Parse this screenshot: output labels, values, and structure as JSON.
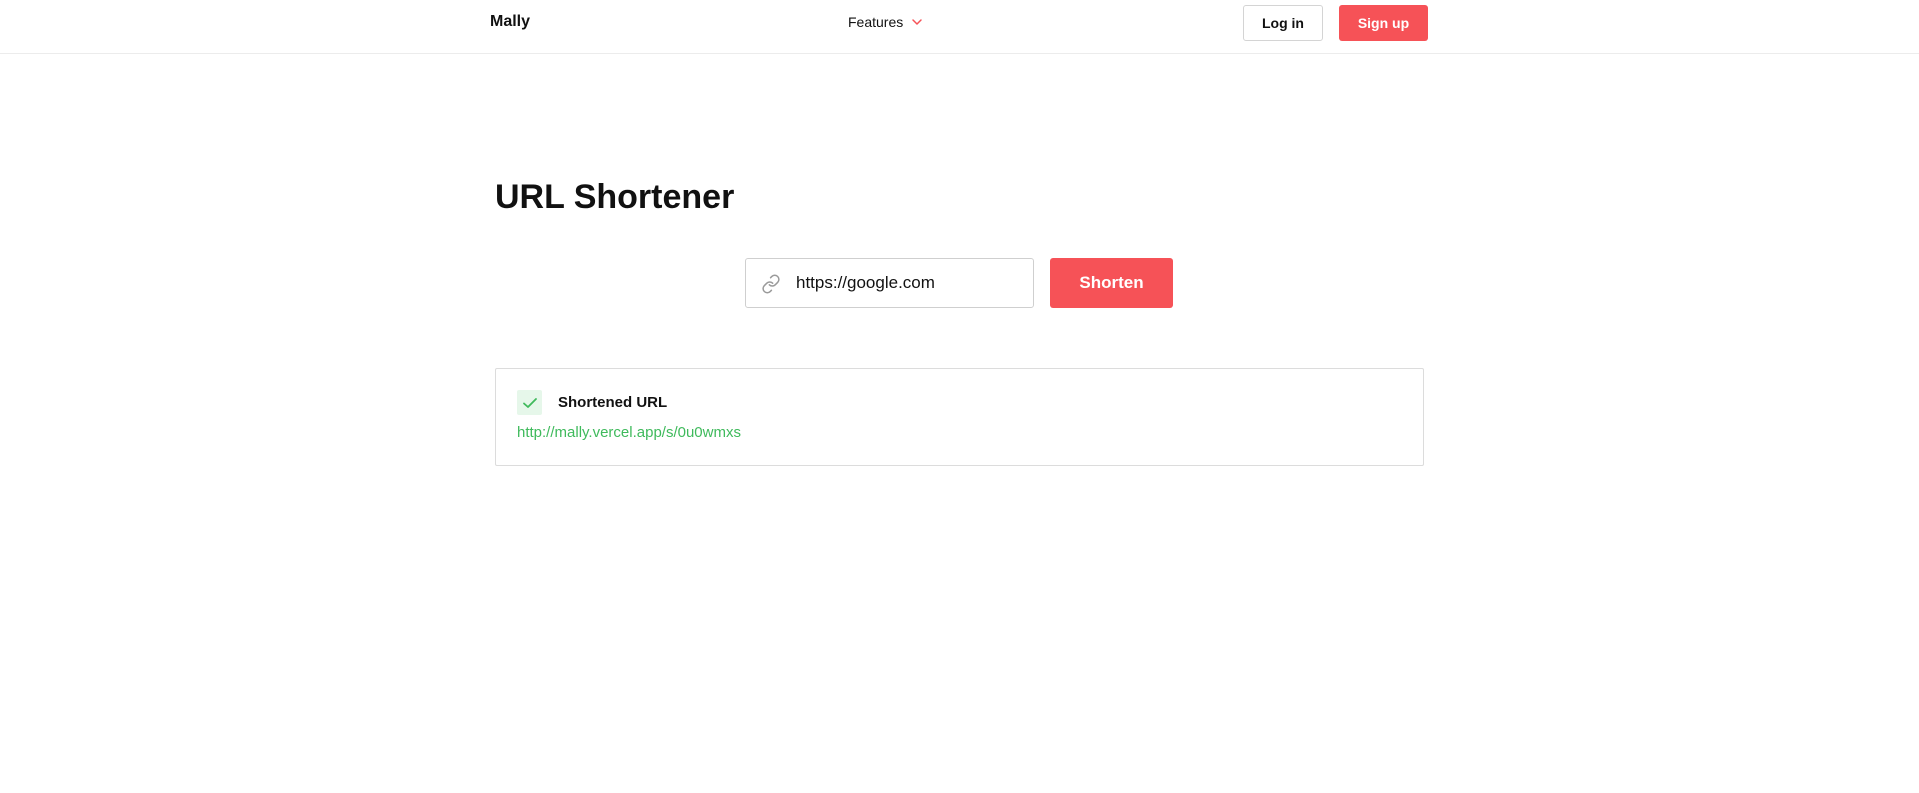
{
  "nav": {
    "brand": "Mally",
    "features_label": "Features",
    "login_label": "Log in",
    "signup_label": "Sign up"
  },
  "main": {
    "title": "URL Shortener",
    "url_input_value": "https://google.com",
    "shorten_label": "Shorten"
  },
  "result": {
    "label": "Shortened URL",
    "short_url": "http://mally.vercel.app/s/0u0wmxs"
  },
  "icons": {
    "chevron": "chevron-down-icon",
    "link": "link-icon",
    "check": "check-icon"
  },
  "colors": {
    "accent": "#f65257",
    "success": "#3fba5c",
    "success_bg": "#e6f7ea"
  }
}
